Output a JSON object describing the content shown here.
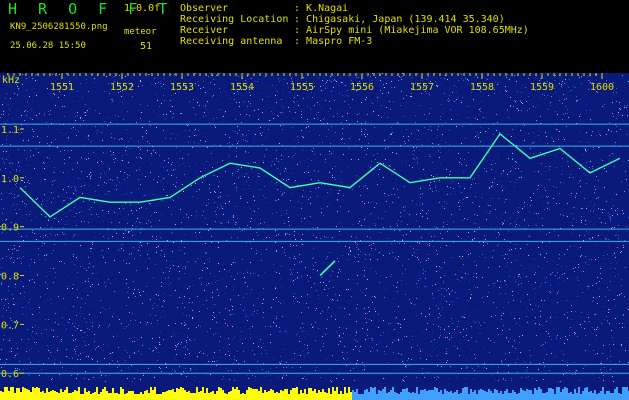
{
  "app": {
    "title": "H R O F F T",
    "version": "1.0.0f",
    "filename": "KN9_2506281550.png",
    "meteor_label": "meteor",
    "datetime": "25.06.28 15:50",
    "meteor_count": "51"
  },
  "info": [
    {
      "label": "Observer",
      "value": "K.Nagai"
    },
    {
      "label": "Receiving Location",
      "value": "Chigasaki, Japan (139.414 35.340)"
    },
    {
      "label": "Receiver",
      "value": "AirSpy mini (Miakejima VOR 108.65MHz)"
    },
    {
      "label": "Receiving antenna",
      "value": "Maspro FM-3"
    }
  ],
  "colors": {
    "background": "#0a1a7a",
    "text": "#e0e000",
    "title": "#20e020",
    "signal": "#40ffb0",
    "noise_bar": "#ffff00"
  },
  "chart_data": {
    "type": "heatmap",
    "ylabel": "kHz",
    "x_tick_labels": [
      "1551",
      "1552",
      "1553",
      "1554",
      "1555",
      "1556",
      "1557",
      "1558",
      "1559",
      "1600"
    ],
    "y_tick_labels": [
      "1.1",
      "1.0",
      "0.9",
      "0.8",
      "0.7",
      "0.6"
    ],
    "ylim": [
      0.58,
      1.19
    ],
    "horizontal_lines_khz": [
      1.11,
      1.065,
      0.895,
      0.87,
      0.618,
      0.6
    ],
    "doppler_trace": {
      "name": "",
      "x_min": [
        0.0,
        0.5,
        1.0,
        1.5,
        2.0,
        2.5,
        3.0,
        3.5,
        4.0,
        4.5,
        5.0,
        5.5,
        6.0,
        6.5,
        7.0,
        7.5,
        8.0,
        8.5,
        9.0,
        9.5,
        10.0
      ],
      "y_khz": [
        0.98,
        0.92,
        0.96,
        0.95,
        0.95,
        0.96,
        1.0,
        1.03,
        1.02,
        0.98,
        0.99,
        0.98,
        1.03,
        0.99,
        1.0,
        1.0,
        1.09,
        1.04,
        1.06,
        1.01,
        1.04
      ]
    },
    "meteor_trace": {
      "x_min": [
        5.0,
        5.25
      ],
      "y_khz": [
        0.8,
        0.83
      ]
    }
  }
}
